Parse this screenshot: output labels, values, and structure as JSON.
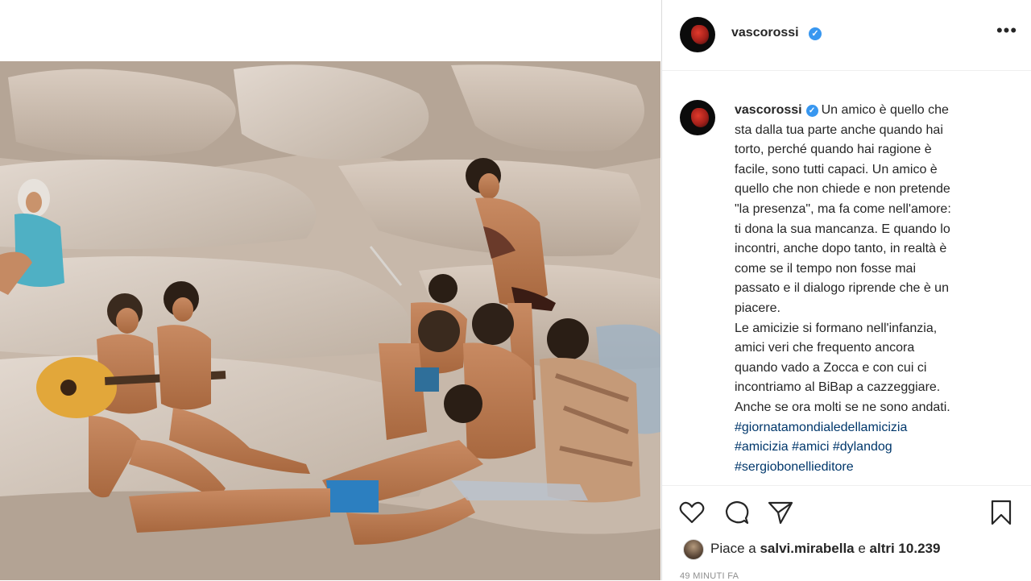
{
  "post": {
    "username": "vascorossi",
    "verified_mark": "✓",
    "more_label": "•••",
    "photo_alt": "Foto"
  },
  "caption": {
    "username": "vascorossi",
    "lines": [
      "Un amico è quello che",
      "sta dalla tua parte anche quando hai",
      "torto, perché quando hai ragione è",
      "facile, sono tutti capaci. Un amico è",
      "quello che non chiede e non pretende",
      "\"la presenza\", ma fa come nell'amore:",
      "ti dona la sua mancanza. E quando lo",
      "incontri, anche dopo tanto, in realtà è",
      "come se il tempo non fosse mai",
      "passato e il dialogo riprende che è un",
      "piacere.",
      "Le amicizie si formano nell'infanzia,",
      "amici veri che frequento ancora",
      "quando vado a Zocca e con cui ci",
      "incontriamo al BiBap a cazzeggiare.",
      "Anche se ora molti se ne sono andati."
    ],
    "hashtags": [
      "#giornatamondialedellamicizia",
      "#amicizia",
      "#amici",
      "#dylandog",
      "#sergiobonellieditore"
    ]
  },
  "actions": {
    "like_icon": "heart-icon",
    "comment_icon": "comment-icon",
    "share_icon": "paper-plane-icon",
    "save_icon": "bookmark-icon"
  },
  "likes": {
    "prefix": "Piace a ",
    "user": "salvi.mirabella",
    "middle": " e ",
    "others": "altri 10.239"
  },
  "timestamp": "49 MINUTI FA",
  "colors": {
    "verified_blue": "#3897f0",
    "hashtag_blue": "#00376b",
    "text": "#262626",
    "muted": "#8e8e8e",
    "border": "#dbdbdb"
  }
}
